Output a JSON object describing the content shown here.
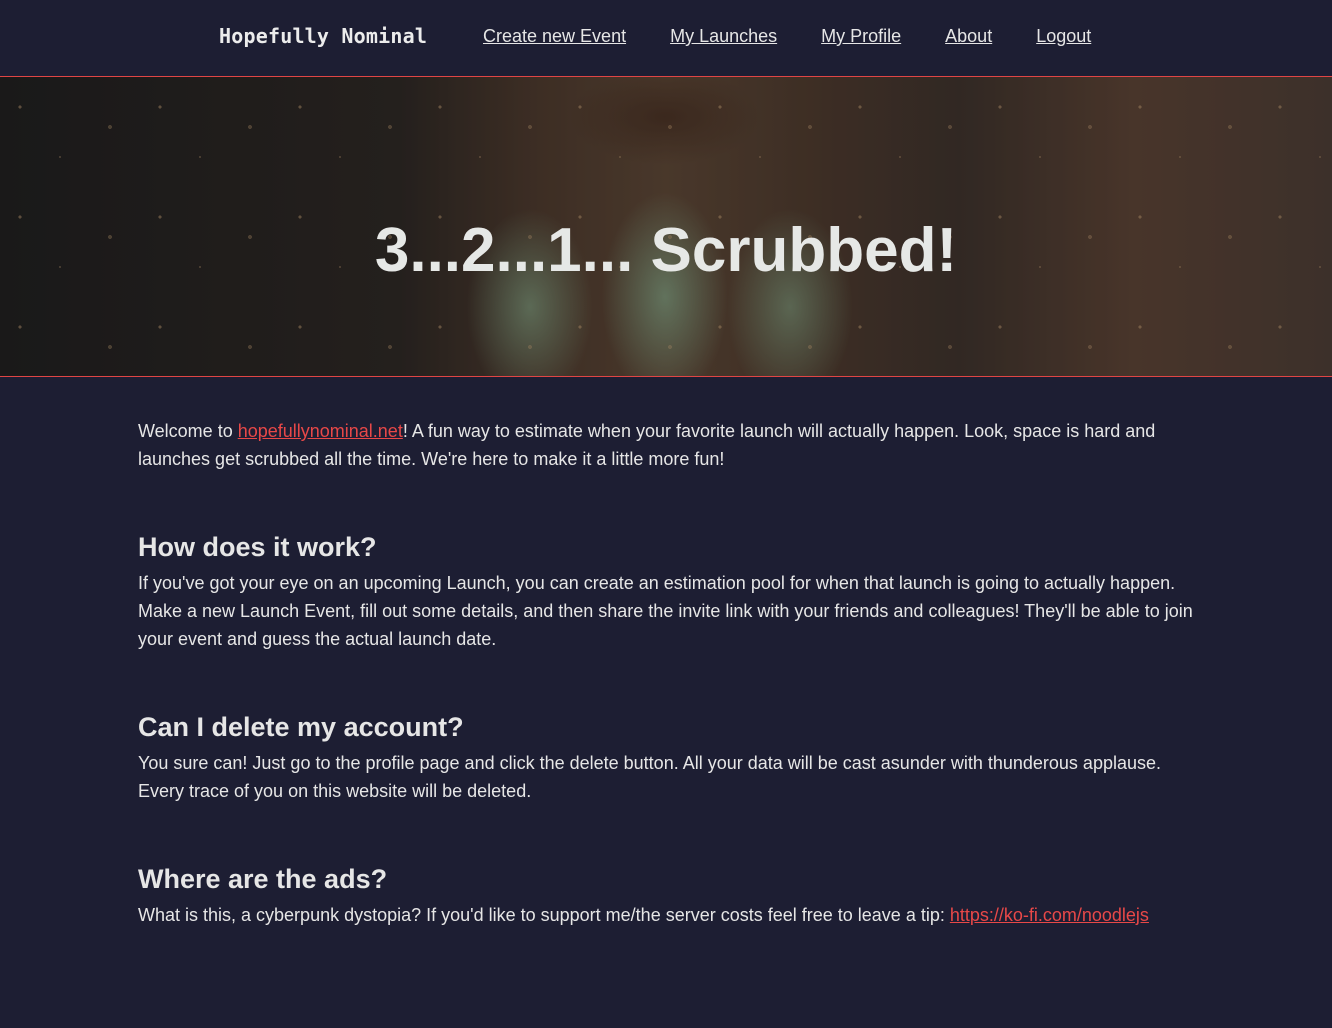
{
  "navbar": {
    "brand": "Hopefully Nominal",
    "links": [
      {
        "label": "Create new Event"
      },
      {
        "label": "My Launches"
      },
      {
        "label": "My Profile"
      },
      {
        "label": "About"
      },
      {
        "label": "Logout"
      }
    ]
  },
  "hero": {
    "title": "3...2...1... Scrubbed!",
    "image": "rocket-launch-engines"
  },
  "intro": {
    "prefix": "Welcome to ",
    "link_text": "hopefullynominal.net",
    "suffix": "! A fun way to estimate when your favorite launch will actually happen. Look, space is hard and launches get scrubbed all the time. We're here to make it a little more fun!"
  },
  "faq": [
    {
      "question": "How does it work?",
      "answer": "If you've got your eye on an upcoming Launch, you can create an estimation pool for when that launch is going to actually happen. Make a new Launch Event, fill out some details, and then share the invite link with your friends and colleagues! They'll be able to join your event and guess the actual launch date."
    },
    {
      "question": "Can I delete my account?",
      "answer": "You sure can! Just go to the profile page and click the delete button. All your data will be cast asunder with thunderous applause. Every trace of you on this website will be deleted."
    },
    {
      "question": "Where are the ads?",
      "answer_prefix": "What is this, a cyberpunk dystopia? If you'd like to support me/the server costs feel free to leave a tip: ",
      "link_text": "https://ko-fi.com/noodlejs"
    }
  ],
  "colors": {
    "background": "#1d1e33",
    "accent": "#e84848",
    "text": "#e6e6e6"
  }
}
